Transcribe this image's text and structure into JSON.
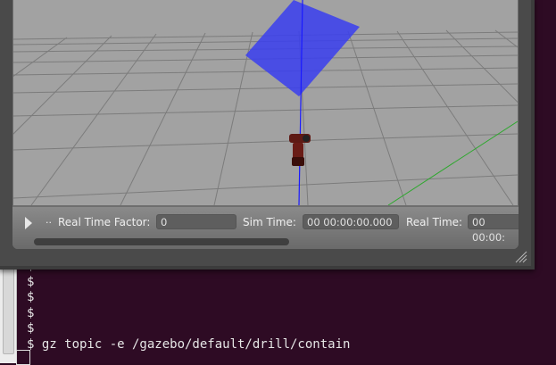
{
  "terminal": {
    "prompt_lines": [
      "$",
      "$",
      "$",
      "$",
      "$"
    ],
    "command_line": "$ gz topic -e /gazebo/default/drill/contain"
  },
  "gazebo": {
    "real_time_factor_label": "Real Time Factor:",
    "real_time_factor_value": "0",
    "sim_time_label": "Sim Time:",
    "sim_time_value": "00 00:00:00.000",
    "real_time_label": "Real Time:",
    "real_time_value": "00 00:00:",
    "step_label": ".."
  },
  "colors": {
    "contain_box": "#3a3ef0",
    "z_axis": "#1a1aff",
    "y_axis": "#2ea82e",
    "drill_body": "#6a1c16"
  }
}
